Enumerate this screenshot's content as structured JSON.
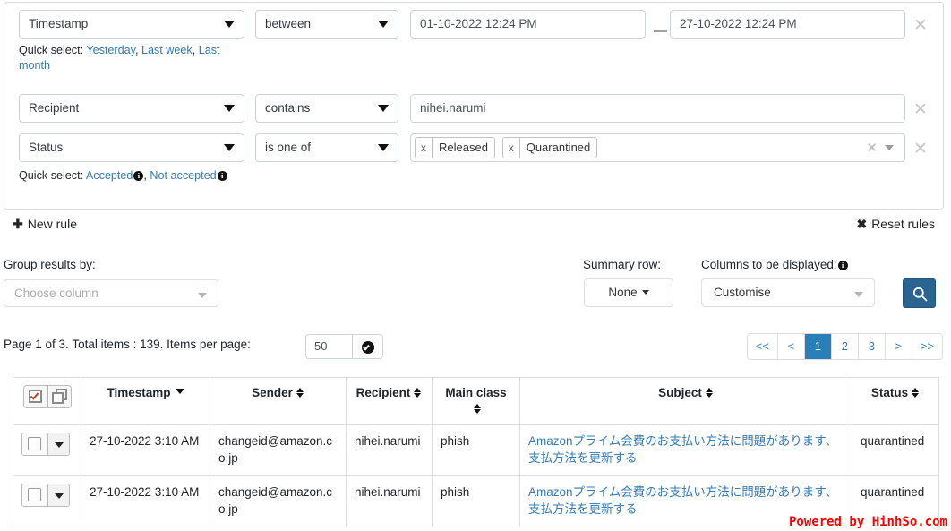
{
  "filters": {
    "rules": [
      {
        "field": "Timestamp",
        "operator": "between",
        "value_from": "01-10-2022 12:24 PM",
        "value_to": "27-10-2022 12:24 PM",
        "separator": "—",
        "remove_label": "✕",
        "quick_select_label": "Quick select:",
        "quick_links": [
          "Yesterday",
          "Last week",
          "Last month"
        ]
      },
      {
        "field": "Recipient",
        "operator": "contains",
        "value": "nihei.narumi",
        "remove_label": "✕"
      },
      {
        "field": "Status",
        "operator": "is one of",
        "tags": [
          "Released",
          "Quarantined"
        ],
        "tag_remove_label": "x",
        "clear_all_label": "✕",
        "remove_label": "✕",
        "quick_select_label": "Quick select:",
        "quick_links": [
          "Accepted",
          "Not accepted"
        ]
      }
    ],
    "new_rule_label": "New rule",
    "new_rule_glyph": "✚",
    "reset_rules_label": "Reset rules",
    "reset_rules_glyph": "✖"
  },
  "options": {
    "group_label": "Group results by:",
    "group_placeholder": "Choose column",
    "summary_label": "Summary row:",
    "summary_value": "None",
    "columns_label": "Columns to be displayed:",
    "columns_value": "Customise",
    "search_icon": "search-icon"
  },
  "paging": {
    "summary": "Page 1 of 3. Total items : 139. Items per page:",
    "items_per_page": "50",
    "apply_icon": "check-circle-icon",
    "buttons": [
      "<<",
      "<",
      "1",
      "2",
      "3",
      ">",
      ">>"
    ],
    "active_index": 2
  },
  "table": {
    "select_all_icon": "checked-box-icon",
    "select_copy_icon": "copy-stack-icon",
    "columns": [
      {
        "label": "Timestamp",
        "sort": "desc"
      },
      {
        "label": "Sender",
        "sort": "both"
      },
      {
        "label": "Recipient",
        "sort": "both"
      },
      {
        "label": "Main class",
        "sort": "both"
      },
      {
        "label": "Subject",
        "sort": "both"
      },
      {
        "label": "Status",
        "sort": "both"
      }
    ],
    "rows": [
      {
        "timestamp": "27-10-2022 3:10 AM",
        "sender": "changeid@amazon.co.jp",
        "recipient": "nihei.narumi",
        "main_class": "phish",
        "subject": "Amazonプライム会費のお支払い方法に問題があります、支払方法を更新する",
        "status": "quarantined"
      },
      {
        "timestamp": "27-10-2022 3:10 AM",
        "sender": "changeid@amazon.co.jp",
        "recipient": "nihei.narumi",
        "main_class": "phish",
        "subject": "Amazonプライム会費のお支払い方法に問題があります、支払方法を更新する",
        "status": "quarantined"
      }
    ]
  },
  "watermark": "Powered by HinhSo.com",
  "colors": {
    "link": "#337ab7",
    "accent": "#2a6490",
    "pager_active": "#2980b9",
    "watermark": "#ff0000"
  }
}
